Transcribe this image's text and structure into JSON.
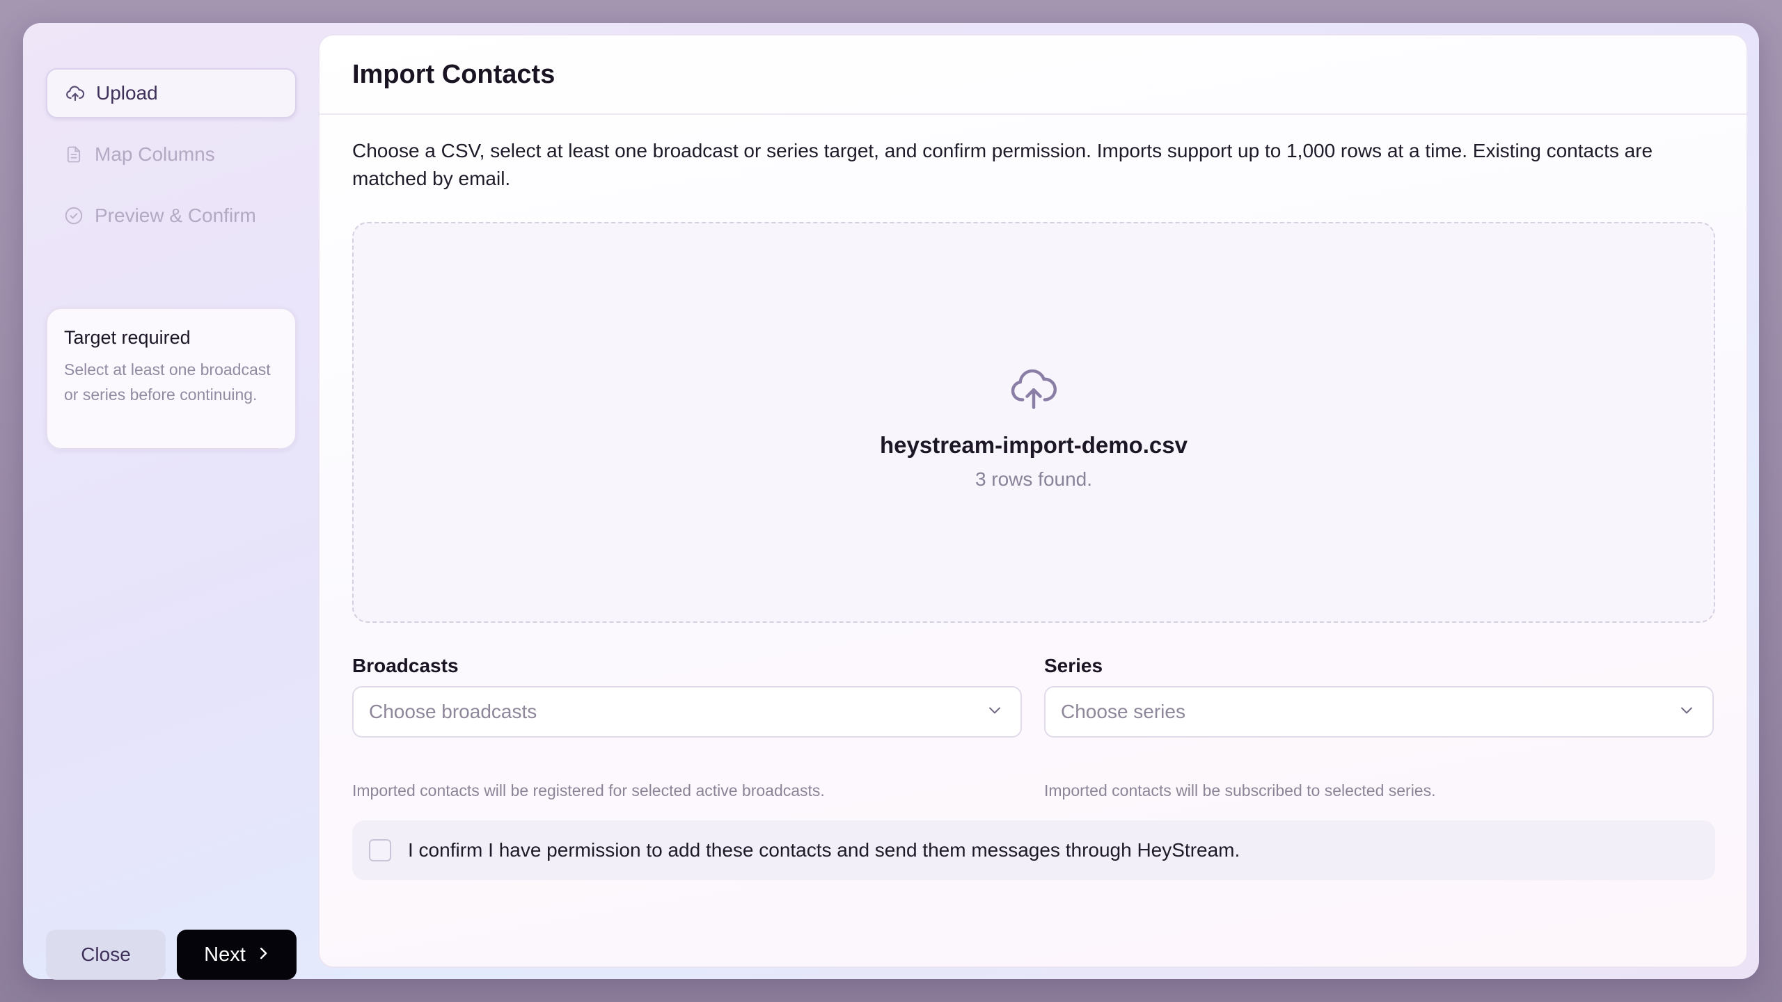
{
  "sidebar": {
    "steps": [
      {
        "label": "Upload",
        "icon": "cloud-upload-icon",
        "active": true
      },
      {
        "label": "Map Columns",
        "icon": "document-icon",
        "active": false
      },
      {
        "label": "Preview & Confirm",
        "icon": "check-circle-icon",
        "active": false
      }
    ],
    "notice": {
      "title": "Target required",
      "description": "Select at least one broadcast or series before continuing."
    },
    "close_label": "Close",
    "next_label": "Next"
  },
  "main": {
    "title": "Import Contacts",
    "description": "Choose a CSV, select at least one broadcast or series target, and confirm permission. Imports support up to 1,000 rows at a time. Existing contacts are matched by email.",
    "dropzone": {
      "file_name": "heystream-import-demo.csv",
      "rows_text": "3 rows found."
    },
    "broadcasts": {
      "label": "Broadcasts",
      "placeholder": "Choose broadcasts",
      "hint": "Imported contacts will be registered for selected active broadcasts."
    },
    "series": {
      "label": "Series",
      "placeholder": "Choose series",
      "hint": "Imported contacts will be subscribed to selected series."
    },
    "confirm_text": "I confirm I have permission to add these contacts and send them messages through HeyStream.",
    "confirm_checked": false
  },
  "colors": {
    "accent": "#3f315a",
    "primary_button": "#05040a",
    "icon": "#8a7ea6"
  }
}
